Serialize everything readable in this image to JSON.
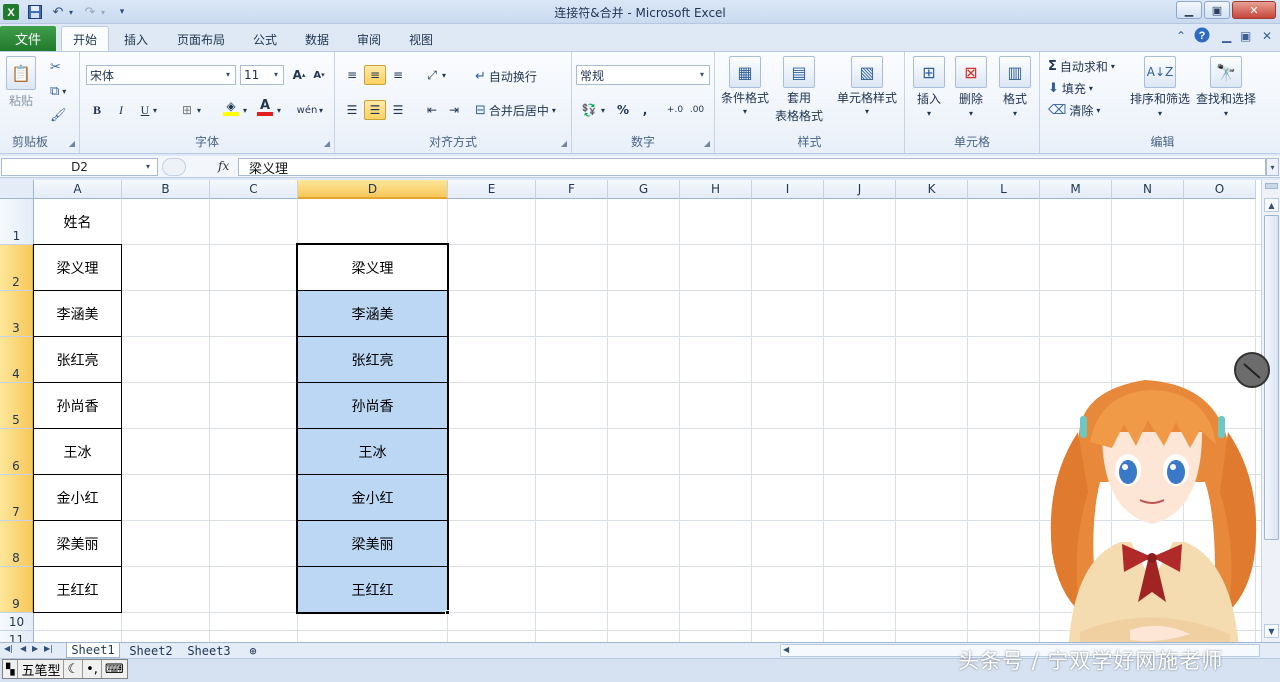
{
  "window": {
    "title": "连接符&合并  -  Microsoft Excel",
    "minimize": "▁",
    "maximize": "▣",
    "close": "✕"
  },
  "ribbon_tabs": [
    {
      "label": "文件"
    },
    {
      "label": "开始"
    },
    {
      "label": "插入"
    },
    {
      "label": "页面布局"
    },
    {
      "label": "公式"
    },
    {
      "label": "数据"
    },
    {
      "label": "审阅"
    },
    {
      "label": "视图"
    }
  ],
  "ribbon": {
    "clipboard": {
      "paste": "粘贴",
      "group": "剪贴板"
    },
    "font": {
      "name": "宋体",
      "size": "11",
      "group": "字体"
    },
    "alignment": {
      "wrap": "自动换行",
      "merge": "合并后居中",
      "group": "对齐方式"
    },
    "number": {
      "format": "常规",
      "group": "数字"
    },
    "styles": {
      "conditional": "条件格式",
      "table1": "套用",
      "table2": "表格格式",
      "cell_styles": "单元格样式",
      "group": "样式"
    },
    "cells": {
      "insert": "插入",
      "delete": "删除",
      "format": "格式",
      "group": "单元格"
    },
    "editing": {
      "autosum": "自动求和",
      "fill": "填充",
      "clear": "清除",
      "sort": "排序和筛选",
      "find": "查找和选择",
      "group": "编辑"
    }
  },
  "formula_bar": {
    "name_box": "D2",
    "fx": "fx",
    "content": "梁义理"
  },
  "columns": [
    "A",
    "B",
    "C",
    "D",
    "E",
    "F",
    "G",
    "H",
    "I",
    "J",
    "K",
    "L",
    "M",
    "N",
    "O"
  ],
  "rows": [
    "1",
    "2",
    "3",
    "4",
    "5",
    "6",
    "7",
    "8",
    "9",
    "10",
    "11"
  ],
  "header_cell": "姓名",
  "names_a": [
    "梁义理",
    "李涵美",
    "张红亮",
    "孙尚香",
    "王冰",
    "金小红",
    "梁美丽",
    "王红红"
  ],
  "names_d": [
    "梁义理",
    "李涵美",
    "张红亮",
    "孙尚香",
    "王冰",
    "金小红",
    "梁美丽",
    "王红红"
  ],
  "sheets": [
    "Sheet1",
    "Sheet2",
    "Sheet3"
  ],
  "ime": {
    "mode": "五笔型"
  },
  "watermark": "头条号 / 宁双学好网施老师",
  "colors": {
    "selection_fill": "#bcd7f4",
    "header_highlight": "#f7c85a",
    "file_tab": "#217a2c"
  }
}
